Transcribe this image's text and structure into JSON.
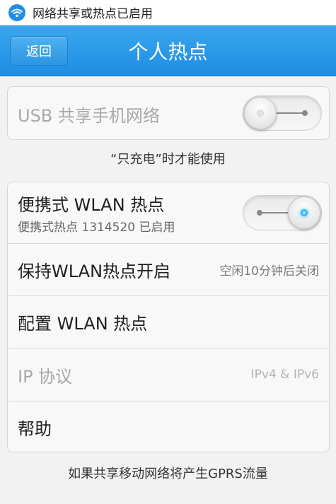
{
  "status_bar": {
    "icon": "wifi-icon",
    "text": "网络共享或热点已启用"
  },
  "header": {
    "back_label": "返回",
    "title": "个人热点"
  },
  "usb_section": {
    "label": "USB 共享手机网络",
    "toggle_state": "off",
    "caption": "“只充电”时才能使用"
  },
  "wlan_section": {
    "items": [
      {
        "label": "便携式 WLAN 热点",
        "sub": "便携式热点 1314520 已启用",
        "toggle_state": "on"
      },
      {
        "label": "保持WLAN热点开启",
        "value": "空闲10分钟后关闭"
      },
      {
        "label": "配置 WLAN 热点"
      },
      {
        "label": "IP 协议",
        "value": "IPv4 & IPv6",
        "disabled": true
      },
      {
        "label": "帮助"
      }
    ]
  },
  "footer": {
    "note": "如果共享移动网络将产生GPRS流量"
  },
  "colors": {
    "title_bar": "#1e8ee3",
    "background": "#f2f2f2",
    "toggle_on_led": "#1fb4f0"
  }
}
